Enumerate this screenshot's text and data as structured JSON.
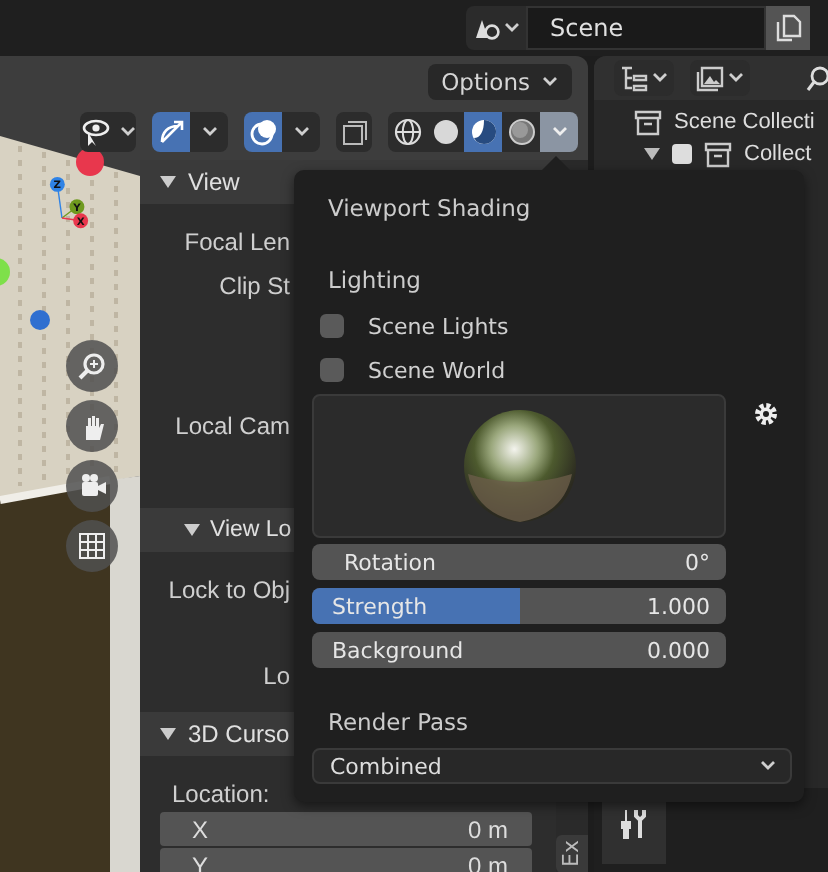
{
  "topbar": {
    "scene": "Scene"
  },
  "viewport": {
    "options_button": "Options",
    "shading_modes": [
      {
        "kind": "wireframe",
        "selected": false
      },
      {
        "kind": "solid",
        "selected": false
      },
      {
        "kind": "material",
        "selected": true
      },
      {
        "kind": "rendered",
        "selected": false
      }
    ],
    "gizmo": [
      {
        "label": "Z",
        "color": "#2f83e6"
      },
      {
        "label": "Y",
        "color": "#6f9a1f"
      },
      {
        "label": "X",
        "color": "#e8374d"
      }
    ]
  },
  "sidebar": {
    "sections": [
      {
        "title": "View",
        "expanded": true,
        "rows": [
          "Focal Len",
          "Clip St",
          "Local Cam"
        ]
      },
      {
        "title": "View Lo",
        "expanded": true,
        "rows": [
          "Lock to Obj",
          "Lo"
        ]
      },
      {
        "title": "3D Curso",
        "expanded": true,
        "label": "Location:",
        "fields": [
          {
            "axis": "X",
            "value": "0 m"
          },
          {
            "axis": "Y",
            "value": "0 m"
          }
        ]
      }
    ],
    "tab": "Ex"
  },
  "outliner": {
    "items": [
      {
        "kind": "scene",
        "label": "Scene Collecti"
      },
      {
        "kind": "collection",
        "label": "Collect",
        "checked": true
      }
    ]
  },
  "popover": {
    "title": "Viewport Shading",
    "lighting": "Lighting",
    "options": [
      {
        "label": "Scene Lights",
        "checked": false
      },
      {
        "label": "Scene World",
        "checked": false
      }
    ],
    "sliders": [
      {
        "kind": "number",
        "label": "Rotation",
        "value": "0°"
      },
      {
        "kind": "slider",
        "label": "Strength",
        "value": "1.000",
        "level": 0.5
      },
      {
        "kind": "slider",
        "label": "Background",
        "value": "0.000",
        "level": 0
      }
    ],
    "render_pass": {
      "label": "Render Pass",
      "value": "Combined"
    }
  }
}
